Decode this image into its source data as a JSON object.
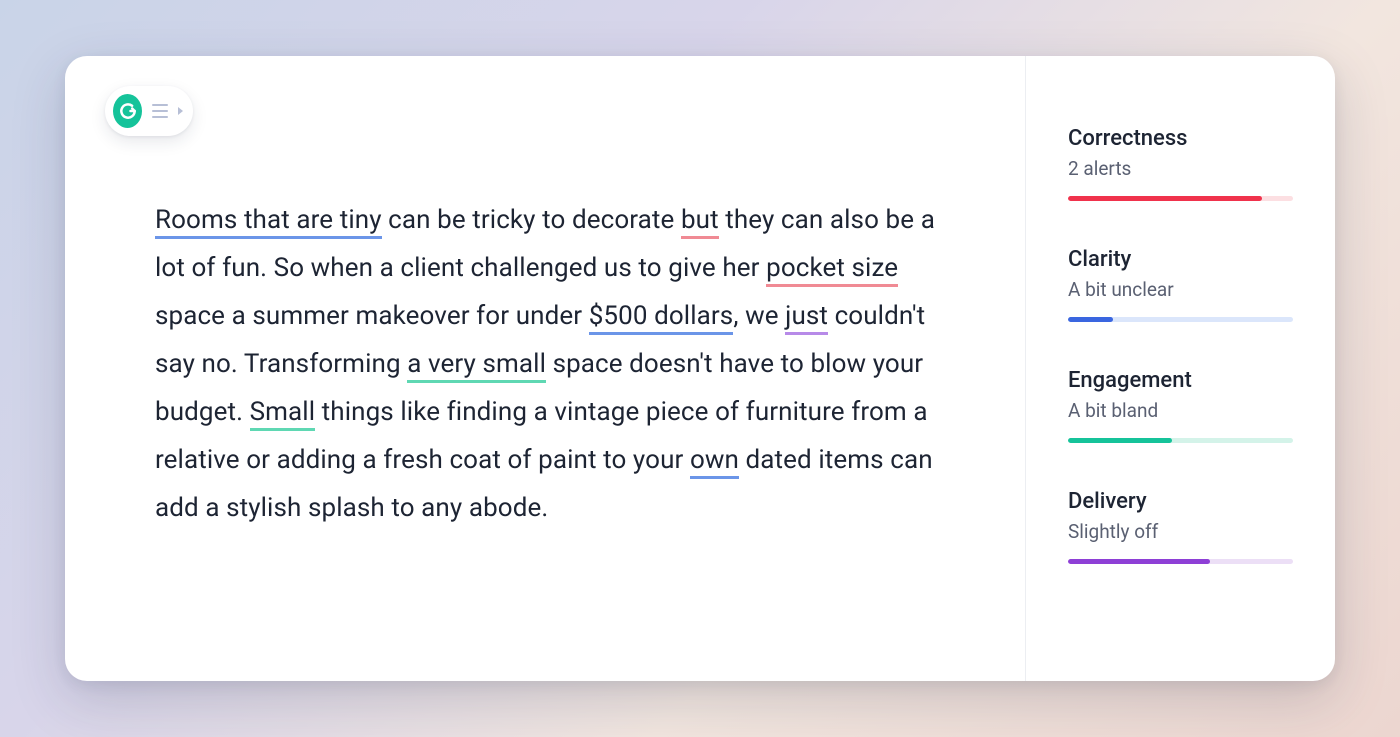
{
  "doc": {
    "segments": [
      {
        "text": "Rooms that are tiny",
        "underline": "blue"
      },
      {
        "text": " can be tricky to decorate "
      },
      {
        "text": "but",
        "underline": "pink"
      },
      {
        "text": " they can also be a lot of fun.  So when a client challenged us to give her "
      },
      {
        "text": "pocket size",
        "underline": "pink"
      },
      {
        "text": " space a summer makeover for under "
      },
      {
        "text": "$500 dollars",
        "underline": "blue"
      },
      {
        "text": ", we "
      },
      {
        "text": "just",
        "underline": "purple"
      },
      {
        "text": " couldn't say no. Transforming "
      },
      {
        "text": "a very small",
        "underline": "teal"
      },
      {
        "text": " space doesn't have to blow your budget. "
      },
      {
        "text": "Small",
        "underline": "teal"
      },
      {
        "text": " things like finding a vintage piece of furniture from a relative or adding a fresh coat of paint to your "
      },
      {
        "text": "own",
        "underline": "blue"
      },
      {
        "text": " dated items can add a stylish splash to any abode."
      }
    ]
  },
  "underline_colors": {
    "blue": "#6b95e8",
    "pink": "#f08a94",
    "purple": "#b78ae8",
    "teal": "#5fd8b3"
  },
  "metrics": [
    {
      "key": "correctness",
      "title": "Correctness",
      "sub": "2 alerts",
      "color": "red",
      "track": "red",
      "percent": 86
    },
    {
      "key": "clarity",
      "title": "Clarity",
      "sub": "A bit unclear",
      "color": "blue",
      "track": "blue",
      "percent": 20
    },
    {
      "key": "engagement",
      "title": "Engagement",
      "sub": "A bit bland",
      "color": "teal",
      "track": "teal",
      "percent": 46
    },
    {
      "key": "delivery",
      "title": "Delivery",
      "sub": "Slightly off",
      "color": "purple",
      "track": "purple",
      "percent": 63
    }
  ],
  "brand": {
    "accent": "#15c39a"
  }
}
